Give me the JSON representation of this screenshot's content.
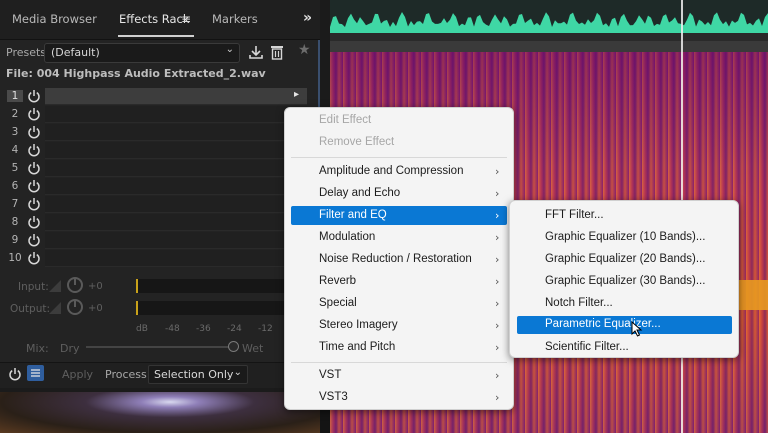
{
  "tabs": {
    "media_browser": "Media Browser",
    "effects_rack": "Effects Rack",
    "effects_rack_menu_icon": "hamburger-menu-icon",
    "markers": "Markers",
    "overflow": "»"
  },
  "presets": {
    "label": "Presets:",
    "value": "(Default)"
  },
  "file": {
    "label": "File: 004 Highpass Audio Extracted_2.wav"
  },
  "rack_slots": [
    "1",
    "2",
    "3",
    "4",
    "5",
    "6",
    "7",
    "8",
    "9",
    "10"
  ],
  "io": {
    "input_label": "Input:",
    "input_value": "+0",
    "output_label": "Output:",
    "output_value": "+0",
    "db_ticks": [
      "dB",
      "-48",
      "-36",
      "-24",
      "-12"
    ]
  },
  "mix": {
    "label": "Mix:",
    "dry": "Dry",
    "wet": "Wet",
    "level": 1.0
  },
  "bottom": {
    "apply": "Apply",
    "process_label": "Process:",
    "process_value": "Selection Only"
  },
  "menu": {
    "edit_effect": "Edit Effect",
    "remove_effect": "Remove Effect",
    "items": [
      "Amplitude and Compression",
      "Delay and Echo",
      "Filter and EQ",
      "Modulation",
      "Noise Reduction / Restoration",
      "Reverb",
      "Special",
      "Stereo Imagery",
      "Time and Pitch"
    ],
    "vst": "VST",
    "vst3": "VST3",
    "highlight_color": "#0a78d4"
  },
  "submenu": {
    "items": [
      "FFT Filter...",
      "Graphic Equalizer (10 Bands)...",
      "Graphic Equalizer (20 Bands)...",
      "Graphic Equalizer (30 Bands)...",
      "Notch Filter...",
      "Parametric Equalizer...",
      "Scientific Filter..."
    ]
  },
  "colors": {
    "waveform": "#3fd7a5",
    "panel_border": "#3a4f6e",
    "meter_marker": "#c9a21a"
  }
}
